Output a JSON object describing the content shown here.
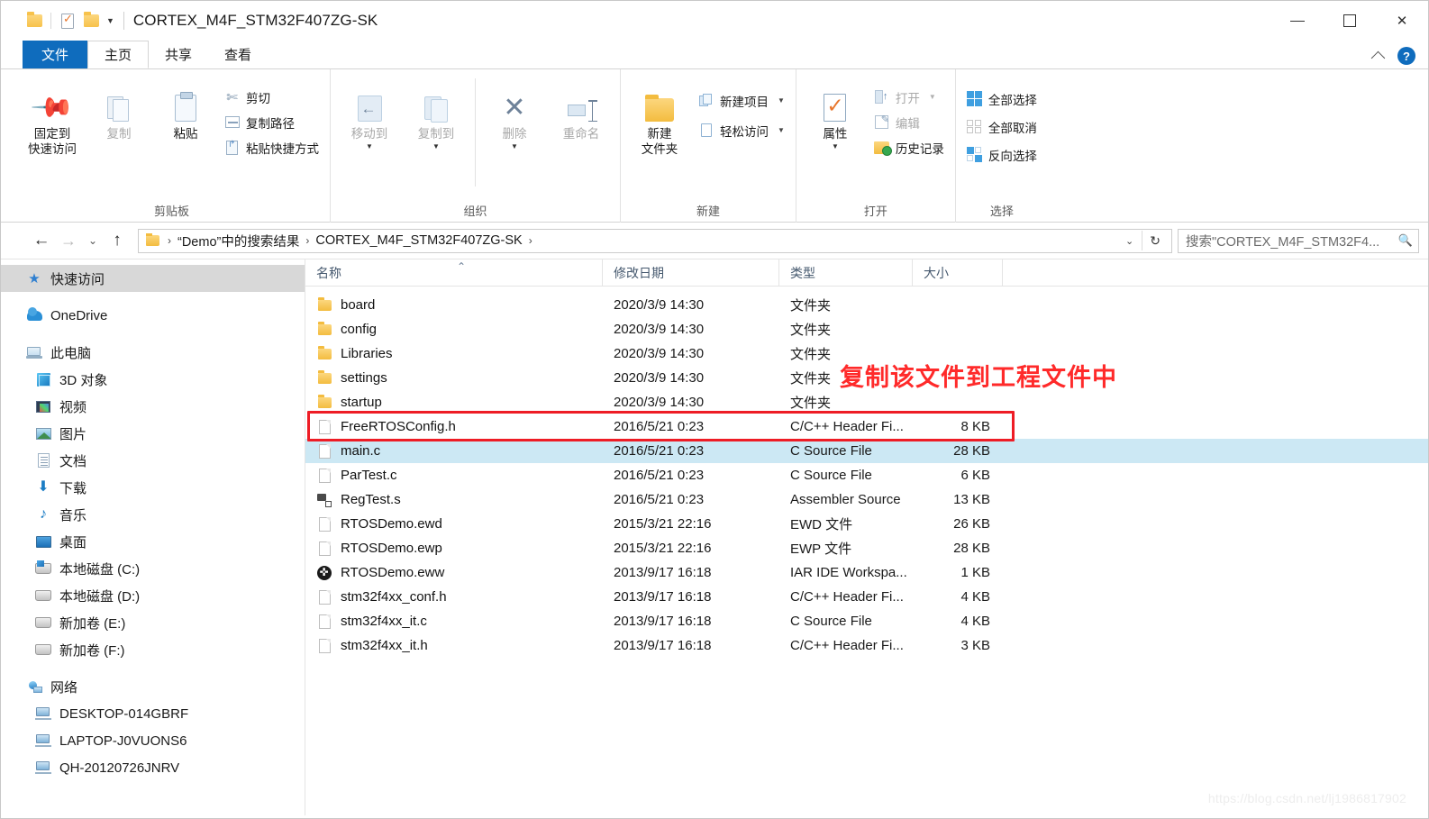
{
  "window": {
    "title": "CORTEX_M4F_STM32F407ZG-SK",
    "quick_access": {
      "folder_icon": "folder-icon",
      "properties_icon": "properties-icon",
      "new_folder_icon": "new-folder-icon",
      "customize_caret": "▾"
    },
    "controls": {
      "minimize": "minimize-icon",
      "maximize": "maximize-icon",
      "close": "✕"
    }
  },
  "tabs": {
    "file": "文件",
    "home": "主页",
    "share": "共享",
    "view": "查看",
    "collapse_icon": "chevron-up-icon",
    "help_icon": "?"
  },
  "ribbon": {
    "groups": [
      {
        "label": "剪贴板"
      },
      {
        "label": "组织"
      },
      {
        "label": "新建"
      },
      {
        "label": "打开"
      },
      {
        "label": "选择"
      }
    ],
    "clipboard": {
      "pin_label": "固定到\n快速访问",
      "pin_line1": "固定到",
      "pin_line2": "快速访问",
      "copy_label": "复制",
      "paste_label": "粘贴",
      "cut_label": "剪切",
      "copy_path_label": "复制路径",
      "paste_shortcut_label": "粘贴快捷方式"
    },
    "organize": {
      "move_to_label": "移动到",
      "copy_to_label": "复制到",
      "delete_label": "删除",
      "rename_label": "重命名"
    },
    "new": {
      "new_folder_line1": "新建",
      "new_folder_line2": "文件夹",
      "new_item_label": "新建项目",
      "easy_access_label": "轻松访问"
    },
    "open": {
      "properties_label": "属性",
      "open_label": "打开",
      "edit_label": "编辑",
      "history_label": "历史记录"
    },
    "select": {
      "select_all_label": "全部选择",
      "select_none_label": "全部取消",
      "invert_label": "反向选择"
    }
  },
  "addressbar": {
    "back_icon": "←",
    "forward_icon": "→",
    "recent_icon": "⌄",
    "up_icon": "↑",
    "folder_icon": "folder-icon",
    "crumbs": [
      "“Demo”中的搜索结果",
      "CORTEX_M4F_STM32F407ZG-SK"
    ],
    "separator": "›",
    "dropdown_icon": "⌄",
    "refresh_icon": "↻",
    "search_placeholder": "搜索\"CORTEX_M4F_STM32F4...",
    "search_icon": "search-icon"
  },
  "sidebar": {
    "items": [
      {
        "label": "快速访问",
        "icon": "star-icon",
        "level": 0,
        "selected": true
      },
      {
        "gap": true
      },
      {
        "label": "OneDrive",
        "icon": "cloud-icon",
        "level": 0
      },
      {
        "gap": true
      },
      {
        "label": "此电脑",
        "icon": "pc-icon",
        "level": 0
      },
      {
        "label": "3D 对象",
        "icon": "3d-icon",
        "level": 1
      },
      {
        "label": "视频",
        "icon": "video-icon",
        "level": 1
      },
      {
        "label": "图片",
        "icon": "picture-icon",
        "level": 1
      },
      {
        "label": "文档",
        "icon": "document-icon",
        "level": 1
      },
      {
        "label": "下载",
        "icon": "download-icon",
        "level": 1
      },
      {
        "label": "音乐",
        "icon": "music-icon",
        "level": 1
      },
      {
        "label": "桌面",
        "icon": "desktop-icon",
        "level": 1
      },
      {
        "label": "本地磁盘 (C:)",
        "icon": "system-disk-icon",
        "level": 1
      },
      {
        "label": "本地磁盘 (D:)",
        "icon": "disk-icon",
        "level": 1
      },
      {
        "label": "新加卷 (E:)",
        "icon": "disk-icon",
        "level": 1
      },
      {
        "label": "新加卷 (F:)",
        "icon": "disk-icon",
        "level": 1
      },
      {
        "gap": true
      },
      {
        "label": "网络",
        "icon": "network-icon",
        "level": 0
      },
      {
        "label": "DESKTOP-014GBRF",
        "icon": "computer-icon",
        "level": 1
      },
      {
        "label": "LAPTOP-J0VUONS6",
        "icon": "computer-icon",
        "level": 1
      },
      {
        "label": "QH-20120726JNRV",
        "icon": "computer-icon",
        "level": 1
      }
    ]
  },
  "filelist": {
    "columns": [
      "名称",
      "修改日期",
      "类型",
      "大小"
    ],
    "sort_indicator": "⌃",
    "rows": [
      {
        "name": "board",
        "date": "2020/3/9 14:30",
        "type": "文件夹",
        "size": "",
        "icon": "folder-icon"
      },
      {
        "name": "config",
        "date": "2020/3/9 14:30",
        "type": "文件夹",
        "size": "",
        "icon": "folder-icon"
      },
      {
        "name": "Libraries",
        "date": "2020/3/9 14:30",
        "type": "文件夹",
        "size": "",
        "icon": "folder-icon"
      },
      {
        "name": "settings",
        "date": "2020/3/9 14:30",
        "type": "文件夹",
        "size": "",
        "icon": "folder-icon"
      },
      {
        "name": "startup",
        "date": "2020/3/9 14:30",
        "type": "文件夹",
        "size": "",
        "icon": "folder-icon"
      },
      {
        "name": "FreeRTOSConfig.h",
        "date": "2016/5/21 0:23",
        "type": "C/C++ Header Fi...",
        "size": "8 KB",
        "icon": "file-icon"
      },
      {
        "name": "main.c",
        "date": "2016/5/21 0:23",
        "type": "C Source File",
        "size": "28 KB",
        "icon": "file-icon",
        "selected": true
      },
      {
        "name": "ParTest.c",
        "date": "2016/5/21 0:23",
        "type": "C Source File",
        "size": "6 KB",
        "icon": "file-icon"
      },
      {
        "name": "RegTest.s",
        "date": "2016/5/21 0:23",
        "type": "Assembler Source",
        "size": "13 KB",
        "icon": "assembler-icon"
      },
      {
        "name": "RTOSDemo.ewd",
        "date": "2015/3/21 22:16",
        "type": "EWD 文件",
        "size": "26 KB",
        "icon": "file-icon"
      },
      {
        "name": "RTOSDemo.ewp",
        "date": "2015/3/21 22:16",
        "type": "EWP 文件",
        "size": "28 KB",
        "icon": "file-icon"
      },
      {
        "name": "RTOSDemo.eww",
        "date": "2013/9/17 16:18",
        "type": "IAR IDE Workspa...",
        "size": "1 KB",
        "icon": "iar-icon"
      },
      {
        "name": "stm32f4xx_conf.h",
        "date": "2013/9/17 16:18",
        "type": "C/C++ Header Fi...",
        "size": "4 KB",
        "icon": "file-icon"
      },
      {
        "name": "stm32f4xx_it.c",
        "date": "2013/9/17 16:18",
        "type": "C Source File",
        "size": "4 KB",
        "icon": "file-icon"
      },
      {
        "name": "stm32f4xx_it.h",
        "date": "2013/9/17 16:18",
        "type": "C/C++ Header Fi...",
        "size": "3 KB",
        "icon": "file-icon"
      }
    ]
  },
  "annotation": {
    "text": "复制该文件到工程文件中",
    "color": "#ff2a2a",
    "box_color": "#ee1c25",
    "highlighted_file": "FreeRTOSConfig.h"
  },
  "watermark": {
    "text": "https://blog.csdn.net/lj1986817902"
  }
}
